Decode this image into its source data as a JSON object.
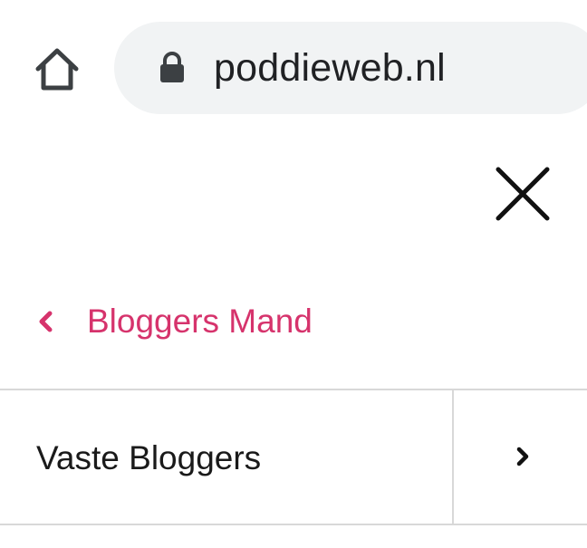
{
  "browser": {
    "url": "poddieweb.nl",
    "icons": {
      "home": "home-icon",
      "lock": "lock-icon"
    }
  },
  "menu": {
    "close_icon": "close-icon",
    "back_label": "Bloggers Mand",
    "back_icon": "chevron-left-icon",
    "items": [
      {
        "label": "Vaste Bloggers",
        "expand_icon": "chevron-right-icon"
      }
    ]
  },
  "colors": {
    "accent": "#d6336c",
    "url_bar_bg": "#f1f3f4",
    "divider": "#d8d8d8",
    "text": "#1a1a1a"
  }
}
